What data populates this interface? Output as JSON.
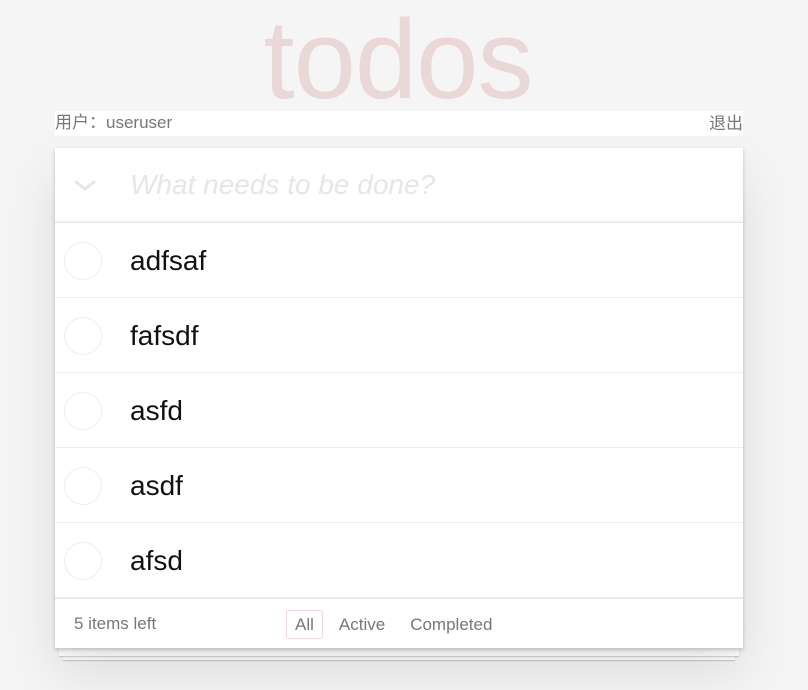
{
  "app": {
    "title": "todos"
  },
  "userbar": {
    "user_text": "用户：useruser",
    "logout_label": "退出"
  },
  "new_todo": {
    "placeholder": "What needs to be done?",
    "value": ""
  },
  "todos": [
    {
      "label": "adfsaf",
      "completed": false
    },
    {
      "label": "fafsdf",
      "completed": false
    },
    {
      "label": "asfd",
      "completed": false
    },
    {
      "label": "asdf",
      "completed": false
    },
    {
      "label": "afsd",
      "completed": false
    }
  ],
  "footer": {
    "count_text": "5 items left",
    "filters": [
      {
        "label": "All",
        "selected": true
      },
      {
        "label": "Active",
        "selected": false
      },
      {
        "label": "Completed",
        "selected": false
      }
    ]
  },
  "colors": {
    "title": "#efd5d5",
    "background": "#f5f5f5",
    "selected_filter_border": "#efd5d5"
  },
  "icons": {
    "toggle_all": "chevron-down-icon"
  }
}
